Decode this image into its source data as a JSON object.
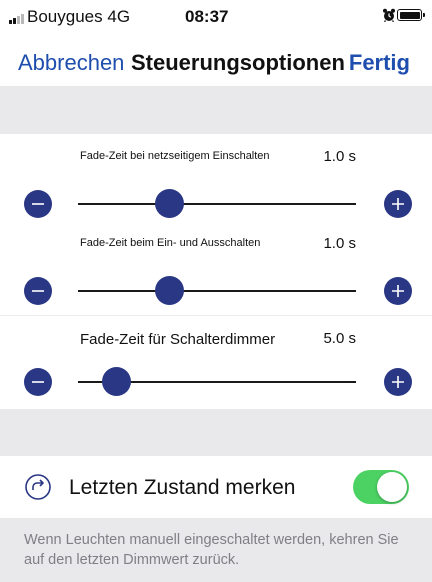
{
  "statusbar": {
    "carrier": "Bouygues",
    "network": "4G",
    "time": "08:37",
    "signal_bars_filled": 2,
    "signal_bars_total": 4,
    "alarm_icon": "alarm-clock-icon",
    "battery_icon": "battery-icon"
  },
  "nav": {
    "cancel_label": "Abbrechen",
    "title": "Steuerungsoptionen",
    "done_label": "Fertig"
  },
  "sliders": [
    {
      "label": "Fade-Zeit bei netzseitigem Einschalten",
      "value_text": "1.0 s",
      "fraction": 0.33,
      "minus_icon": "minus-icon",
      "plus_icon": "plus-icon"
    },
    {
      "label": "Fade-Zeit beim Ein- und Ausschalten",
      "value_text": "1.0 s",
      "fraction": 0.33,
      "minus_icon": "minus-icon",
      "plus_icon": "plus-icon"
    },
    {
      "label": "Fade-Zeit für Schalterdimmer",
      "value_text": "5.0 s",
      "fraction": 0.14,
      "minus_icon": "minus-icon",
      "plus_icon": "plus-icon"
    }
  ],
  "toggle": {
    "label": "Letzten Zustand merken",
    "icon": "restore-icon",
    "on": true
  },
  "footer": {
    "text": "Wenn Leuchten manuell  eingeschaltet werden, kehren Sie auf den letzten Dimmwert zurück."
  },
  "colors": {
    "accent": "#1f4fae",
    "control": "#2a3784",
    "switch_on": "#4cd263",
    "group_background": "#e9e9ec",
    "footer_text": "#7f7f85"
  }
}
